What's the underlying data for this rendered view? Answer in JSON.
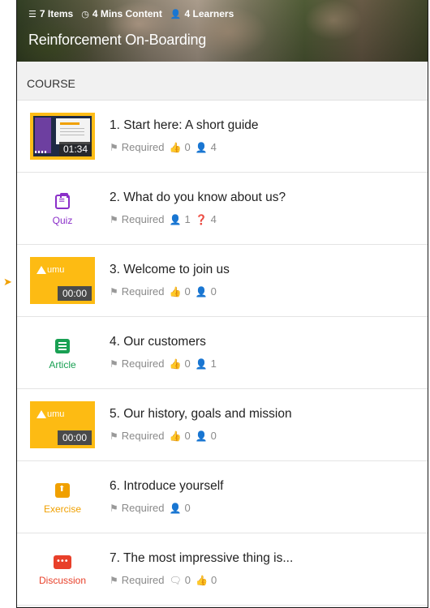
{
  "banner": {
    "items_count": "7 Items",
    "content_duration": "4 Mins Content",
    "learners_count": "4 Learners",
    "title": "Reinforcement On-Boarding"
  },
  "section": {
    "title": "COURSE"
  },
  "colors": {
    "accent_yellow": "#ffbd17",
    "quiz_purple": "#8b2fc9",
    "article_green": "#19a053",
    "exercise_orange": "#f0a000",
    "discussion_red": "#e8402a"
  },
  "items": [
    {
      "title": "1. Start here: A short guide",
      "type": "video",
      "duration": "01:34",
      "required": "Required",
      "likes": "0",
      "learners": "4"
    },
    {
      "title": "2. What do you know about us?",
      "type": "quiz",
      "type_label": "Quiz",
      "required": "Required",
      "learners": "1",
      "questions": "4"
    },
    {
      "title": "3. Welcome to join us",
      "type": "video",
      "brand": "umu",
      "duration": "00:00",
      "required": "Required",
      "likes": "0",
      "learners": "0"
    },
    {
      "title": "4. Our customers",
      "type": "article",
      "type_label": "Article",
      "required": "Required",
      "likes": "0",
      "learners": "1"
    },
    {
      "title": "5. Our history, goals and mission",
      "type": "video",
      "brand": "umu",
      "duration": "00:00",
      "required": "Required",
      "likes": "0",
      "learners": "0"
    },
    {
      "title": "6. Introduce yourself",
      "type": "exercise",
      "type_label": "Exercise",
      "required": "Required",
      "learners": "0"
    },
    {
      "title": "7. The most impressive thing is...",
      "type": "discussion",
      "type_label": "Discussion",
      "required": "Required",
      "comments": "0",
      "likes": "0"
    }
  ]
}
